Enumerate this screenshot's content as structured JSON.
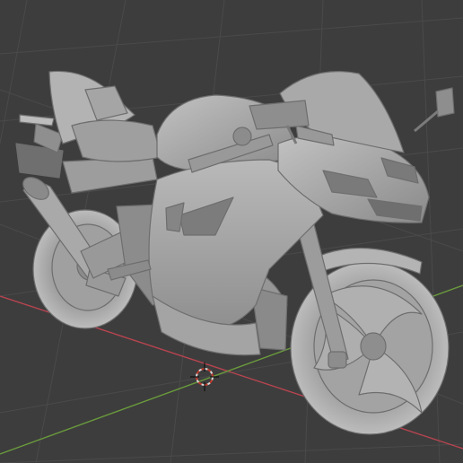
{
  "viewport": {
    "mode": "3d-viewport-solid-shading",
    "background_color": "#3d3d3d",
    "grid_color": "#4a4a4a",
    "x_axis_color": "#b84450",
    "y_axis_color": "#6a9a3c",
    "model_color": "#a6a6a6"
  },
  "scene": {
    "object": "motorcycle-model",
    "cursor_icon": "3d-cursor-icon"
  }
}
